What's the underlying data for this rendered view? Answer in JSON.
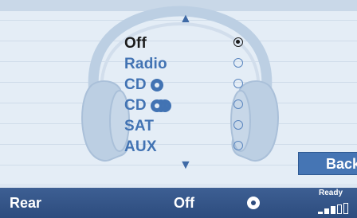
{
  "menu": {
    "items": [
      {
        "label": "Off",
        "selected": true
      },
      {
        "label": "Radio",
        "selected": false
      },
      {
        "label": "CD",
        "icon": "cd-icon",
        "selected": false
      },
      {
        "label": "CD",
        "icon": "cd-changer-icon",
        "selected": false
      },
      {
        "label": "SAT",
        "selected": false
      },
      {
        "label": "AUX",
        "selected": false
      }
    ],
    "scroll_up_icon": "triangle-up-icon",
    "scroll_down_icon": "triangle-down-icon",
    "background_icon": "headphones-icon"
  },
  "back_button": {
    "label": "Back"
  },
  "status": {
    "zone": "Rear",
    "source": "Off",
    "source_icon": "disc-icon",
    "ready": "Ready",
    "signal_icon": "signal-strength-icon"
  },
  "colors": {
    "accent": "#4273b3",
    "status_bar": "#2d4c7e",
    "background": "#e4edf6",
    "selected_text": "#1b1b1b"
  }
}
